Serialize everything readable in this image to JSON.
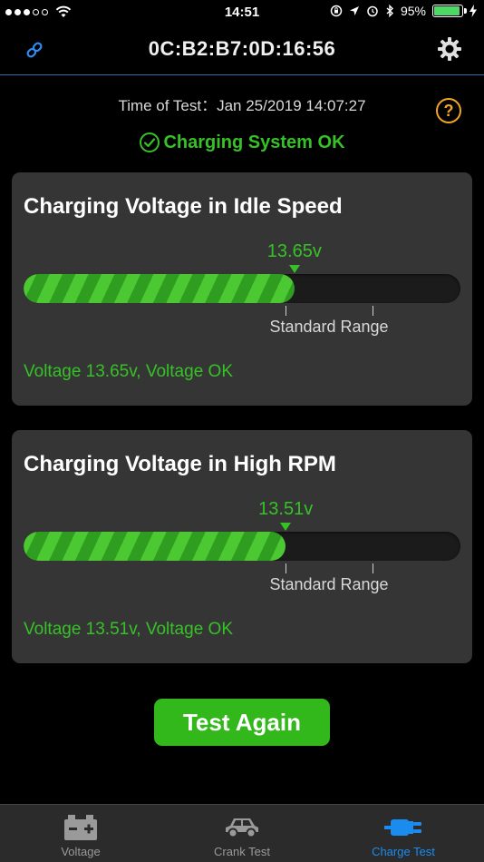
{
  "status_bar": {
    "time": "14:51",
    "battery_percent": "95%",
    "battery_level": 0.95
  },
  "nav": {
    "title": "0C:B2:B7:0D:16:56",
    "link_icon": "link-icon",
    "settings_icon": "gear-icon"
  },
  "test_info": {
    "time_label": "Time of Test：",
    "time_value": "Jan 25/2019 14:07:27",
    "help_glyph": "?",
    "result": "Charging System OK"
  },
  "cards": [
    {
      "title": "Charging Voltage in Idle Speed",
      "marker_value": "13.65v",
      "fill_fraction": 0.62,
      "range_label": "Standard Range",
      "status": "Voltage 13.65v, Voltage OK"
    },
    {
      "title": "Charging Voltage in High RPM",
      "marker_value": "13.51v",
      "fill_fraction": 0.6,
      "range_label": "Standard Range",
      "status": "Voltage 13.51v, Voltage OK"
    }
  ],
  "actions": {
    "test_again": "Test Again"
  },
  "tabs": [
    {
      "label": "Voltage",
      "icon": "battery-icon",
      "active": false
    },
    {
      "label": "Crank Test",
      "icon": "car-icon",
      "active": false
    },
    {
      "label": "Charge Test",
      "icon": "plug-icon",
      "active": true
    }
  ],
  "colors": {
    "accent_green": "#36c226",
    "button_green": "#33b81c",
    "active_tab_blue": "#1a8cf0",
    "help_orange": "#f5a623",
    "card_bg": "#353535"
  }
}
